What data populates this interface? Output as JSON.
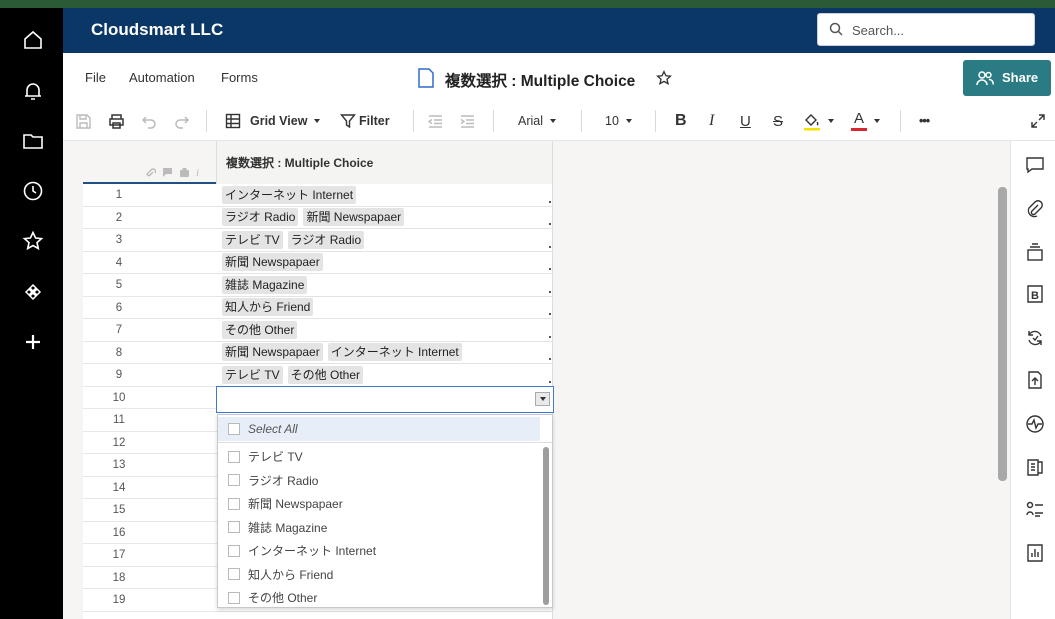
{
  "header": {
    "org_name": "Cloudsmart LLC",
    "search_placeholder": "Search..."
  },
  "menu": {
    "items": [
      "File",
      "Automation",
      "Forms"
    ],
    "sheet_title": "複数選択 : Multiple Choice",
    "share_label": "Share"
  },
  "toolbar": {
    "view_label": "Grid View",
    "filter_label": "Filter",
    "font_family": "Arial",
    "font_size": "10",
    "bold": "B",
    "italic": "I",
    "underline": "U",
    "strike": "S",
    "text_color": "A",
    "more": "•••"
  },
  "grid": {
    "column_header": "複数選択 : Multiple Choice",
    "rows": [
      {
        "num": "1",
        "values": [
          "インターネット Internet"
        ]
      },
      {
        "num": "2",
        "values": [
          "ラジオ Radio",
          "新聞 Newspapaer"
        ]
      },
      {
        "num": "3",
        "values": [
          "テレビ TV",
          "ラジオ Radio"
        ]
      },
      {
        "num": "4",
        "values": [
          "新聞 Newspapaer"
        ]
      },
      {
        "num": "5",
        "values": [
          "雑誌 Magazine"
        ]
      },
      {
        "num": "6",
        "values": [
          "知人から Friend"
        ]
      },
      {
        "num": "7",
        "values": [
          "その他 Other"
        ]
      },
      {
        "num": "8",
        "values": [
          "新聞 Newspapaer",
          "インターネット Internet"
        ]
      },
      {
        "num": "9",
        "values": [
          "テレビ TV",
          "その他 Other"
        ]
      },
      {
        "num": "10",
        "values": []
      },
      {
        "num": "11",
        "values": []
      },
      {
        "num": "12",
        "values": []
      },
      {
        "num": "13",
        "values": []
      },
      {
        "num": "14",
        "values": []
      },
      {
        "num": "15",
        "values": []
      },
      {
        "num": "16",
        "values": []
      },
      {
        "num": "17",
        "values": []
      },
      {
        "num": "18",
        "values": []
      },
      {
        "num": "19",
        "values": []
      }
    ]
  },
  "dropdown": {
    "select_all": "Select All",
    "options": [
      "テレビ TV",
      "ラジオ Radio",
      "新聞 Newspapaer",
      "雑誌 Magazine",
      "インターネット Internet",
      "知人から Friend",
      "その他 Other"
    ]
  },
  "colors": {
    "header_bg": "#0b3766",
    "share_bg": "#2a7b83",
    "nav_bg": "#000000",
    "highlight_yellow": "#f5e100",
    "text_red": "#d9262c"
  }
}
